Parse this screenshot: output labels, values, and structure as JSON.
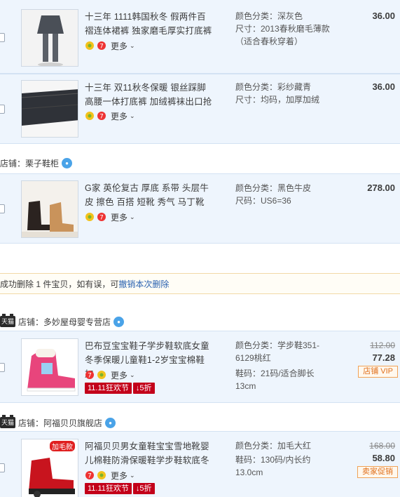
{
  "items": [
    {
      "title": "十三年 1111韩国秋冬 假两件百褶连体裙裤 独家磨毛厚实打底裤",
      "attr1": "颜色分类：深灰色",
      "attr2": "尺寸：2013春秋磨毛薄款",
      "attr3": "（适合春秋穿着）",
      "price": "36.00",
      "more": "更多"
    },
    {
      "title": "十三年 双11秋冬保暖 银丝踩脚高腰一体打底裤 加绒裤袜出口抢",
      "attr1": "颜色分类：彩纱藏青",
      "attr2": "尺寸：均码，加厚加绒",
      "price": "36.00",
      "more": "更多"
    },
    {
      "title": "G家 英伦复古 厚底 系带 头层牛皮 擦色 百搭 短靴 秀气 马丁靴",
      "attr1": "颜色分类：黑色牛皮",
      "attr2": "尺码：US6=36",
      "price": "278.00",
      "more": "更多"
    },
    {
      "title": "巴布豆宝宝鞋子学步鞋软底女童冬季保暖儿童鞋1-2岁宝宝棉鞋加",
      "attr1": "颜色分类：学步鞋351-6129桃红",
      "attr2": "鞋码：21码/适合脚长13cm",
      "old_price": "112.00",
      "price": "77.28",
      "tag": "店铺 VIP",
      "more": "更多",
      "promo1": "11.11狂欢节",
      "promo2": "↓5折"
    },
    {
      "title": "阿福贝贝男女童鞋宝宝雪地靴婴儿棉鞋防滑保暖鞋学步鞋软底冬",
      "attr1": "颜色分类：加毛大红",
      "attr2": "鞋码：130码/内长约13.0cm",
      "old_price": "168.00",
      "price": "58.80",
      "tag": "卖家促销",
      "thumb_badge": "加毛款",
      "more": "更多",
      "promo1": "11.11狂欢节",
      "promo2": "↓5折"
    }
  ],
  "shops": [
    {
      "label": "店铺：",
      "name": "栗子鞋柜"
    },
    {
      "label": "店铺：",
      "name": "多妙屋母婴专营店",
      "tmall": "天猫"
    },
    {
      "label": "店铺：",
      "name": "阿福贝贝旗舰店",
      "tmall": "天猫"
    }
  ],
  "notice": {
    "prefix": "成功删除 1 件宝贝，如有误，可",
    "link": "撤销本次删除"
  },
  "colors": {
    "item_bg": "#eef5fd",
    "promo_red": "#c3001a",
    "link_blue": "#2a62b0"
  }
}
